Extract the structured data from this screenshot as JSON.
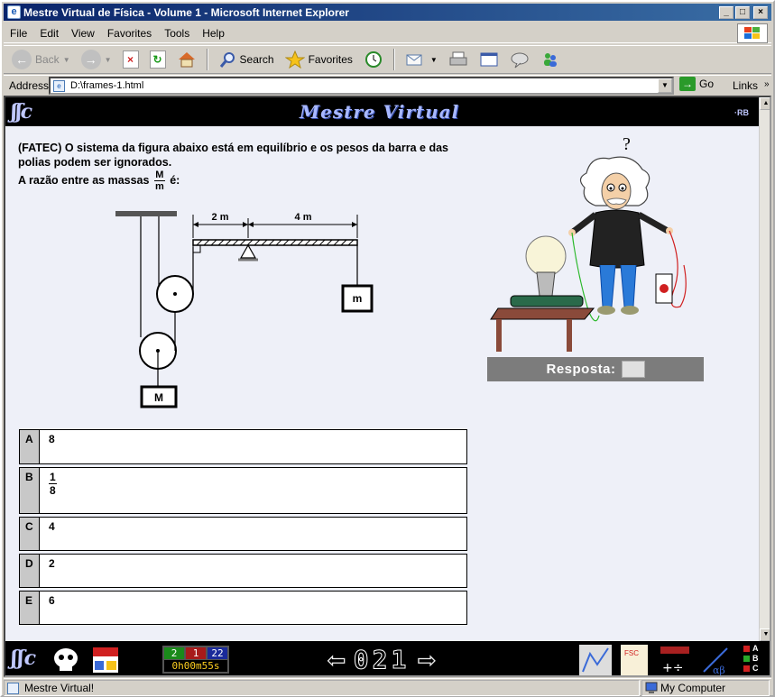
{
  "window": {
    "title": "Mestre Virtual de Física - Volume 1 - Microsoft Internet Explorer",
    "buttons": [
      "_",
      "□",
      "×"
    ]
  },
  "menu": [
    "File",
    "Edit",
    "View",
    "Favorites",
    "Tools",
    "Help"
  ],
  "toolbar": {
    "back": "Back",
    "search": "Search",
    "favorites": "Favorites"
  },
  "address": {
    "label": "Address",
    "value": "D:\\frames-1.html",
    "go": "Go",
    "links": "Links"
  },
  "site": {
    "brand": "Mestre Virtual"
  },
  "question": {
    "line1": "(FATEC) O sistema da figura abaixo está em equilíbrio e os pesos da barra e das polias podem ser ignorados.",
    "line2_prefix": "A razão entre as massas",
    "frac_num": "M",
    "frac_den": "m",
    "line2_suffix": "é:"
  },
  "figure": {
    "dist1": "2 m",
    "dist2": "4 m",
    "small_mass": "m",
    "big_mass": "M"
  },
  "answers": [
    {
      "letter": "A",
      "text": "8"
    },
    {
      "letter": "B",
      "num": "1",
      "den": "8"
    },
    {
      "letter": "C",
      "text": "4"
    },
    {
      "letter": "D",
      "text": "2"
    },
    {
      "letter": "E",
      "text": "6"
    }
  ],
  "resposta": {
    "label": "Resposta:"
  },
  "bottom": {
    "counter": [
      "2",
      "1",
      "22"
    ],
    "counter_colors": [
      "#1a8a1a",
      "#a81a1a",
      "#1a2a9a"
    ],
    "timer": "0h00m55s",
    "page_number": "021",
    "legend": [
      "A",
      "B",
      "C"
    ]
  },
  "status": {
    "left": "Mestre Virtual!",
    "right": "My Computer"
  }
}
